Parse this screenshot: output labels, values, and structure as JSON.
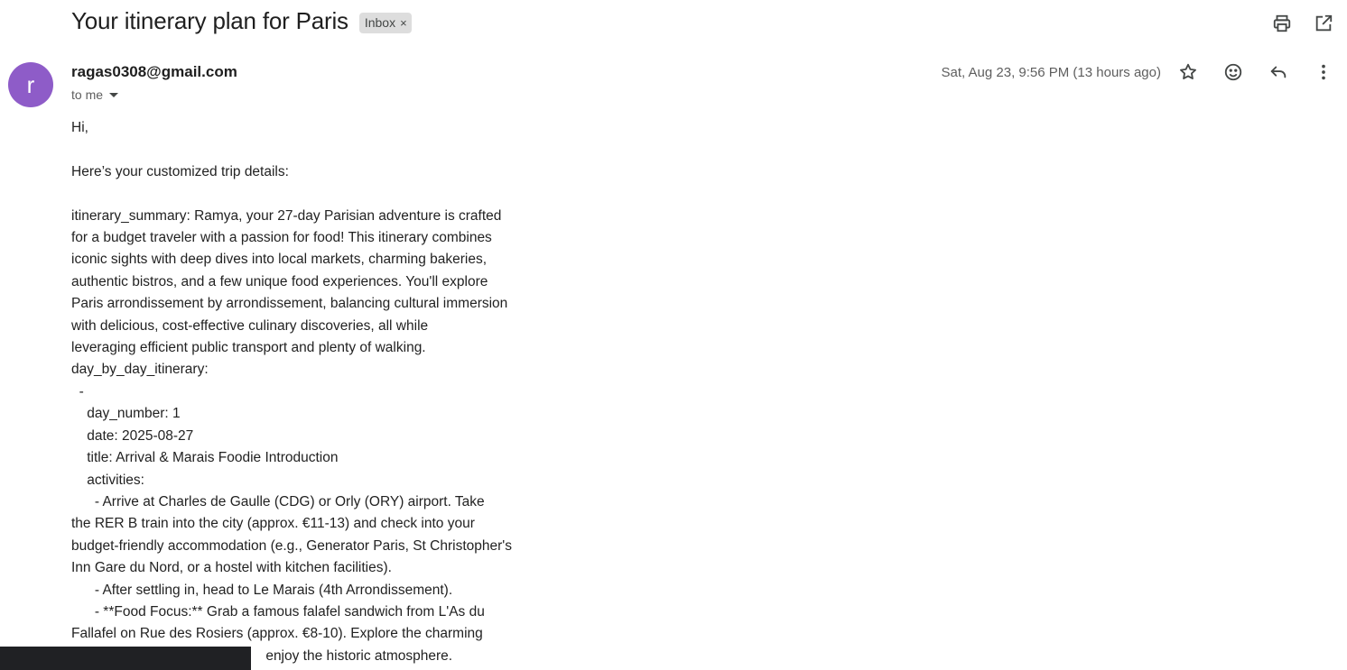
{
  "email": {
    "subject": "Your itinerary plan for Paris",
    "label": "Inbox",
    "label_remove": "×",
    "sender_initial": "r",
    "sender": "ragas0308@gmail.com",
    "recipient": "to me",
    "date": "Sat, Aug 23, 9:56 PM (13 hours ago)",
    "icons": {
      "print": "print-icon",
      "open_new": "open-in-new-window-icon",
      "star": "star-icon",
      "emoji": "emoji-reaction-icon",
      "reply": "reply-icon",
      "more": "more-vert-icon"
    },
    "body_lines": [
      "Hi,",
      "",
      "Here’s your customized trip details:",
      "",
      "itinerary_summary: Ramya, your 27-day Parisian adventure is crafted",
      "for a budget traveler with a passion for food! This itinerary combines",
      "iconic sights with deep dives into local markets, charming bakeries,",
      "authentic bistros, and a few unique food experiences. You'll explore",
      "Paris arrondissement by arrondissement, balancing cultural immersion",
      "with delicious, cost-effective culinary discoveries, all while",
      "leveraging efficient public transport and plenty of walking.",
      "day_by_day_itinerary:",
      "  -",
      "    day_number: 1",
      "    date: 2025-08-27",
      "    title: Arrival & Marais Foodie Introduction",
      "    activities:",
      "      - Arrive at Charles de Gaulle (CDG) or Orly (ORY) airport. Take",
      "the RER B train into the city (approx. €11-13) and check into your",
      "budget-friendly accommodation (e.g., Generator Paris, St Christopher's",
      "Inn Gare du Nord, or a hostel with kitchen facilities).",
      "      - After settling in, head to Le Marais (4th Arrondissement).",
      "      - **Food Focus:** Grab a famous falafel sandwich from L'As du",
      "Fallafel on Rue des Rosiers (approx. €8-10). Explore the charming",
      "                                                  enjoy the historic atmosphere."
    ]
  },
  "colors": {
    "avatar": "#8e5cc8",
    "chip_bg": "#dddddd",
    "toast": "#202124"
  }
}
